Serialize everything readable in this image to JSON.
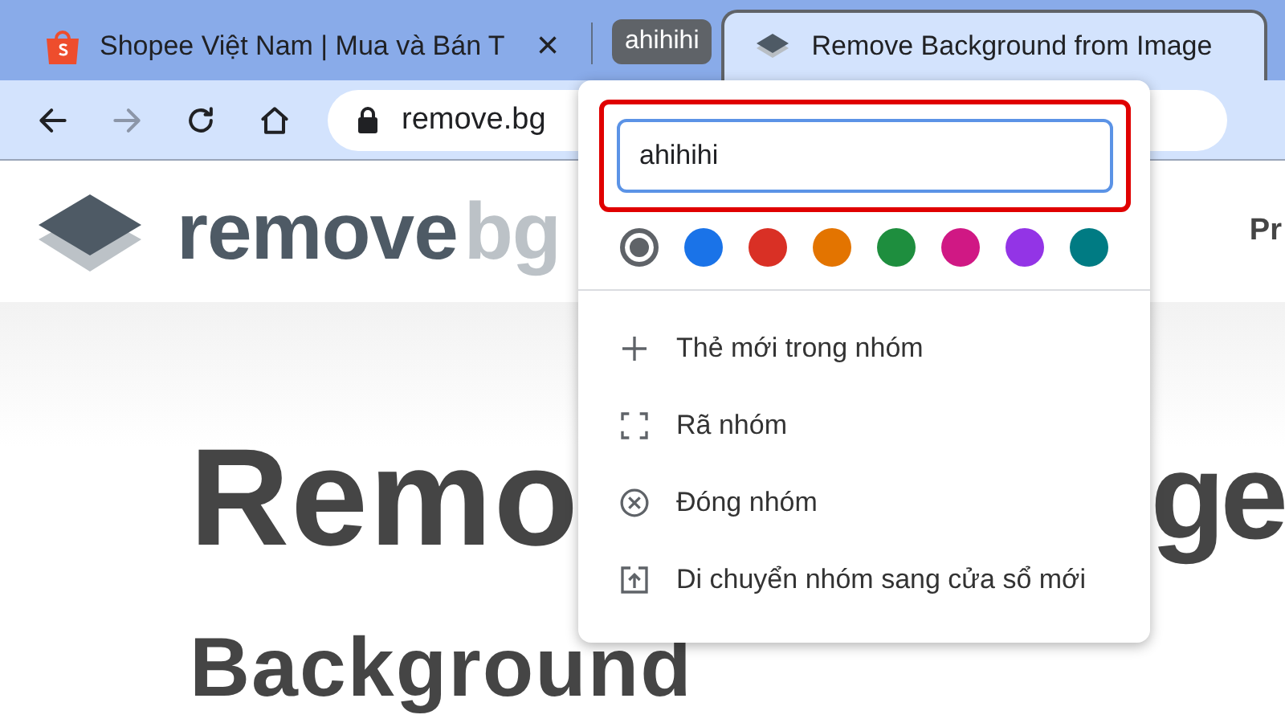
{
  "tabs": [
    {
      "kind": "tab",
      "title": "Shopee Việt Nam | Mua và Bán T",
      "selected": false,
      "close": "×"
    },
    {
      "kind": "group",
      "label": "ahihihi",
      "color": "#5f6368"
    },
    {
      "kind": "tab",
      "title": "Remove Background from Image",
      "selected": true
    }
  ],
  "toolbar": {
    "buttons": [
      {
        "kind": "back",
        "disabled": false
      },
      {
        "kind": "forward",
        "disabled": true
      },
      {
        "kind": "reload",
        "disabled": false
      },
      {
        "kind": "home",
        "disabled": false
      }
    ],
    "address": "remove.bg"
  },
  "page": {
    "logo": {
      "main": "remove",
      "accent": "bg"
    },
    "nav_fragment": "Pr",
    "heading": [
      {
        "left": "Remo",
        "right": "ge"
      },
      {
        "left": "Background"
      }
    ]
  },
  "group_editor": {
    "name_value": "ahihihi",
    "highlighted": true,
    "colors": [
      {
        "color": "#5f6368",
        "selected": true
      },
      {
        "color": "#1a73e8",
        "selected": false
      },
      {
        "color": "#d93025",
        "selected": false
      },
      {
        "color": "#e37400",
        "selected": false
      },
      {
        "color": "#1e8e3e",
        "selected": false
      },
      {
        "color": "#d01884",
        "selected": false
      },
      {
        "color": "#9334e6",
        "selected": false
      },
      {
        "color": "#007b83",
        "selected": false
      }
    ],
    "menu": [
      {
        "kind": "new-tab",
        "label": "Thẻ mới trong nhóm"
      },
      {
        "kind": "ungroup",
        "label": "Rã nhóm"
      },
      {
        "kind": "close",
        "label": "Đóng nhóm"
      },
      {
        "kind": "move",
        "label": "Di chuyển nhóm sang cửa sổ mới"
      }
    ]
  }
}
